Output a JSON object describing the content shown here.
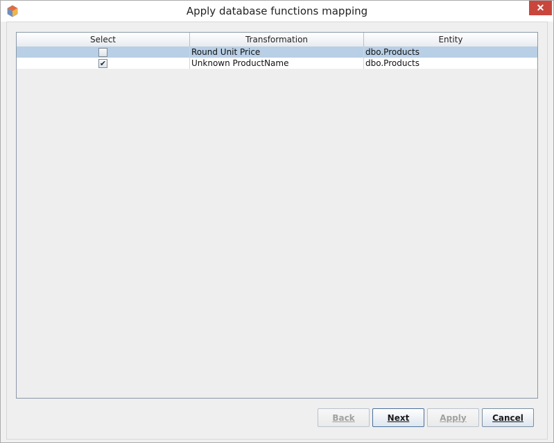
{
  "window": {
    "title": "Apply database functions mapping",
    "close_label": "✕"
  },
  "table": {
    "columns": [
      "Select",
      "Transformation",
      "Entity"
    ],
    "rows": [
      {
        "selected": false,
        "check_mark": "",
        "transformation": "Round Unit Price",
        "entity": "dbo.Products"
      },
      {
        "selected": true,
        "check_mark": "✔",
        "transformation": "Unknown ProductName",
        "entity": "dbo.Products"
      }
    ]
  },
  "buttons": {
    "back": "Back",
    "next": "Next",
    "apply": "Apply",
    "cancel": "Cancel"
  },
  "colors": {
    "selection_highlight": "#b8cfe5",
    "close_button": "#c9463d"
  }
}
